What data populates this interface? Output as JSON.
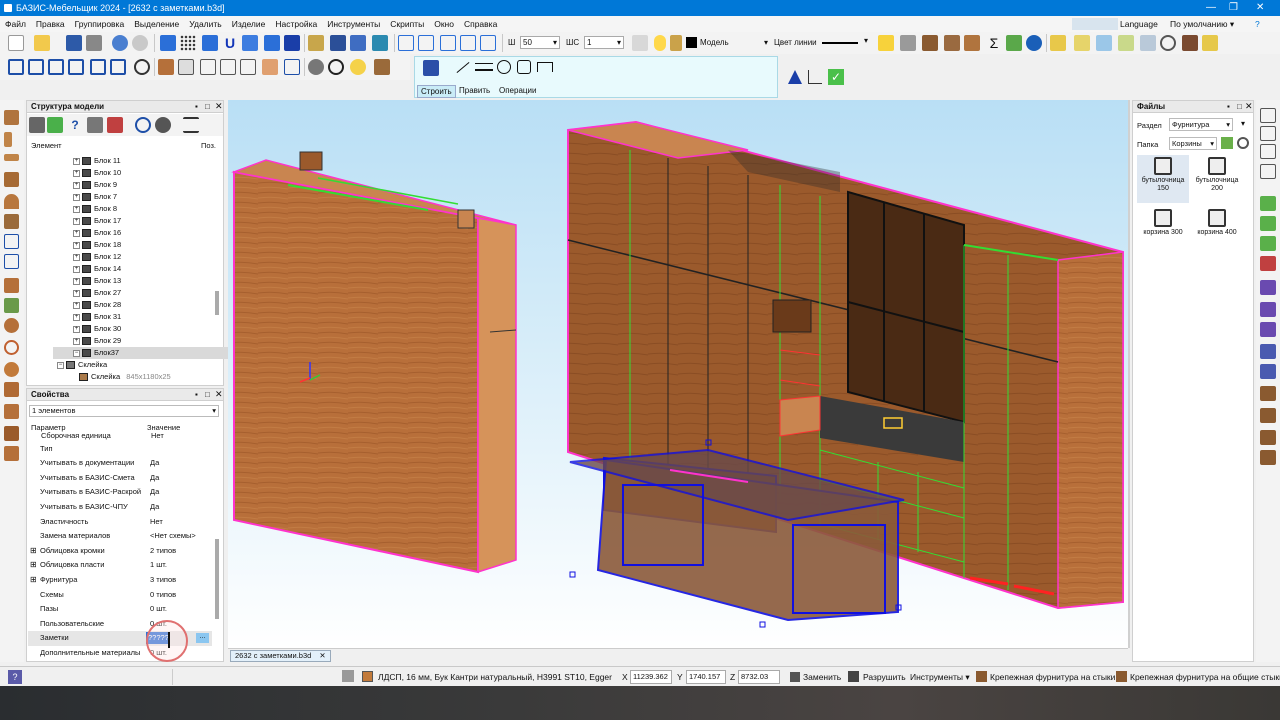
{
  "window": {
    "title": "БАЗИС-Мебельщик 2024 - [2632 с заметками.b3d]"
  },
  "menu": {
    "items": [
      "Файл",
      "Правка",
      "Группировка",
      "Выделение",
      "Удалить",
      "Изделие",
      "Настройка",
      "Инструменты",
      "Скрипты",
      "Окно",
      "Справка"
    ],
    "language": "Language",
    "preset": "По умолчанию"
  },
  "toolbar": {
    "w_label": "Ш",
    "w_value": "50",
    "wc_label": "ШС",
    "wc_value": "1",
    "layer_value": "Модель",
    "line_color_label": "Цвет линии",
    "tabs": [
      "Строить",
      "Править",
      "Операции"
    ]
  },
  "structure": {
    "title": "Структура модели",
    "col_element": "Элемент",
    "col_pos": "Поз.",
    "rows": [
      "Блок 11",
      "Блок 10",
      "Блок 9",
      "Блок 7",
      "Блок 8",
      "Блок 17",
      "Блок 16",
      "Блок 18",
      "Блок 12",
      "Блок 14",
      "Блок 13",
      "Блок 27",
      "Блок 28",
      "Блок 31",
      "Блок 30",
      "Блок 29",
      "Блок37"
    ],
    "child": "Склейка",
    "grandchild": "Склейка",
    "grandchild_dims": "845x1180x25"
  },
  "properties": {
    "title": "Свойства",
    "selection": "1 элементов",
    "col_param": "Параметр",
    "col_value": "Значение",
    "partial_row": {
      "name": "Сборочная единица",
      "value": "Нет"
    },
    "rows": [
      {
        "name": "Тип",
        "value": "",
        "exp": ""
      },
      {
        "name": "Учитывать в документации",
        "value": "Да",
        "exp": ""
      },
      {
        "name": "Учитывать в БАЗИС-Смета",
        "value": "Да",
        "exp": ""
      },
      {
        "name": "Учитывать в БАЗИС-Раскрой",
        "value": "Да",
        "exp": ""
      },
      {
        "name": "Учитывать в БАЗИС-ЧПУ",
        "value": "Да",
        "exp": ""
      },
      {
        "name": "Эластичность",
        "value": "Нет",
        "exp": ""
      },
      {
        "name": "Замена материалов",
        "value": "<Нет схемы>",
        "exp": ""
      },
      {
        "name": "Облицовка кромки",
        "value": "2 типов",
        "exp": "⊞"
      },
      {
        "name": "Облицовка пласти",
        "value": "1 шт.",
        "exp": "⊞"
      },
      {
        "name": "Фурнитура",
        "value": "3 типов",
        "exp": "⊞"
      },
      {
        "name": "Схемы",
        "value": "0 типов",
        "exp": ""
      },
      {
        "name": "Пазы",
        "value": "0 шт.",
        "exp": ""
      },
      {
        "name": "Пользовательские",
        "value": "0 шт.",
        "exp": ""
      },
      {
        "name": "Заметки",
        "value": "",
        "exp": ""
      },
      {
        "name": "Дополнительные материалы",
        "value": "0 шт.",
        "exp": ""
      }
    ],
    "notes_input": "?????",
    "notes_btn": "..."
  },
  "viewport": {
    "doc_tab": "2632 с заметками.b3d"
  },
  "files": {
    "title": "Файлы",
    "section_label": "Раздел",
    "section_value": "Фурнитура",
    "folder_label": "Папка",
    "folder_value": "Корзины",
    "items": [
      {
        "l1": "бутылочница",
        "l2": "150",
        "icon": "bottle-rack-150-icon"
      },
      {
        "l1": "бутылочница",
        "l2": "200",
        "icon": "bottle-rack-200-icon"
      },
      {
        "l1": "корзина 300",
        "l2": "",
        "icon": "basket-300-icon"
      },
      {
        "l1": "корзина 400",
        "l2": "",
        "icon": "basket-400-icon"
      }
    ]
  },
  "status": {
    "material": "ЛДСП, 16 мм, Бук Кантри натуральный, H3991 ST10, Egger",
    "x_label": "X",
    "x": "11239.362",
    "y_label": "Y",
    "y": "1740.157",
    "z_label": "Z",
    "z": "8732.03",
    "replace": "Заменить",
    "break": "Разрушить",
    "tools": "Инструменты",
    "fittings_joints": "Крепежная фурнитура на стыки",
    "fittings_common": "Крепежная фурнитура на общие стыки"
  },
  "colors": {
    "accent": "#0078d7",
    "viewport_top": "#9fd3f5",
    "wood": "#b26a36",
    "selection": "#1010e0",
    "edge_magenta": "#ff33cc",
    "edge_green": "#33dd33"
  }
}
